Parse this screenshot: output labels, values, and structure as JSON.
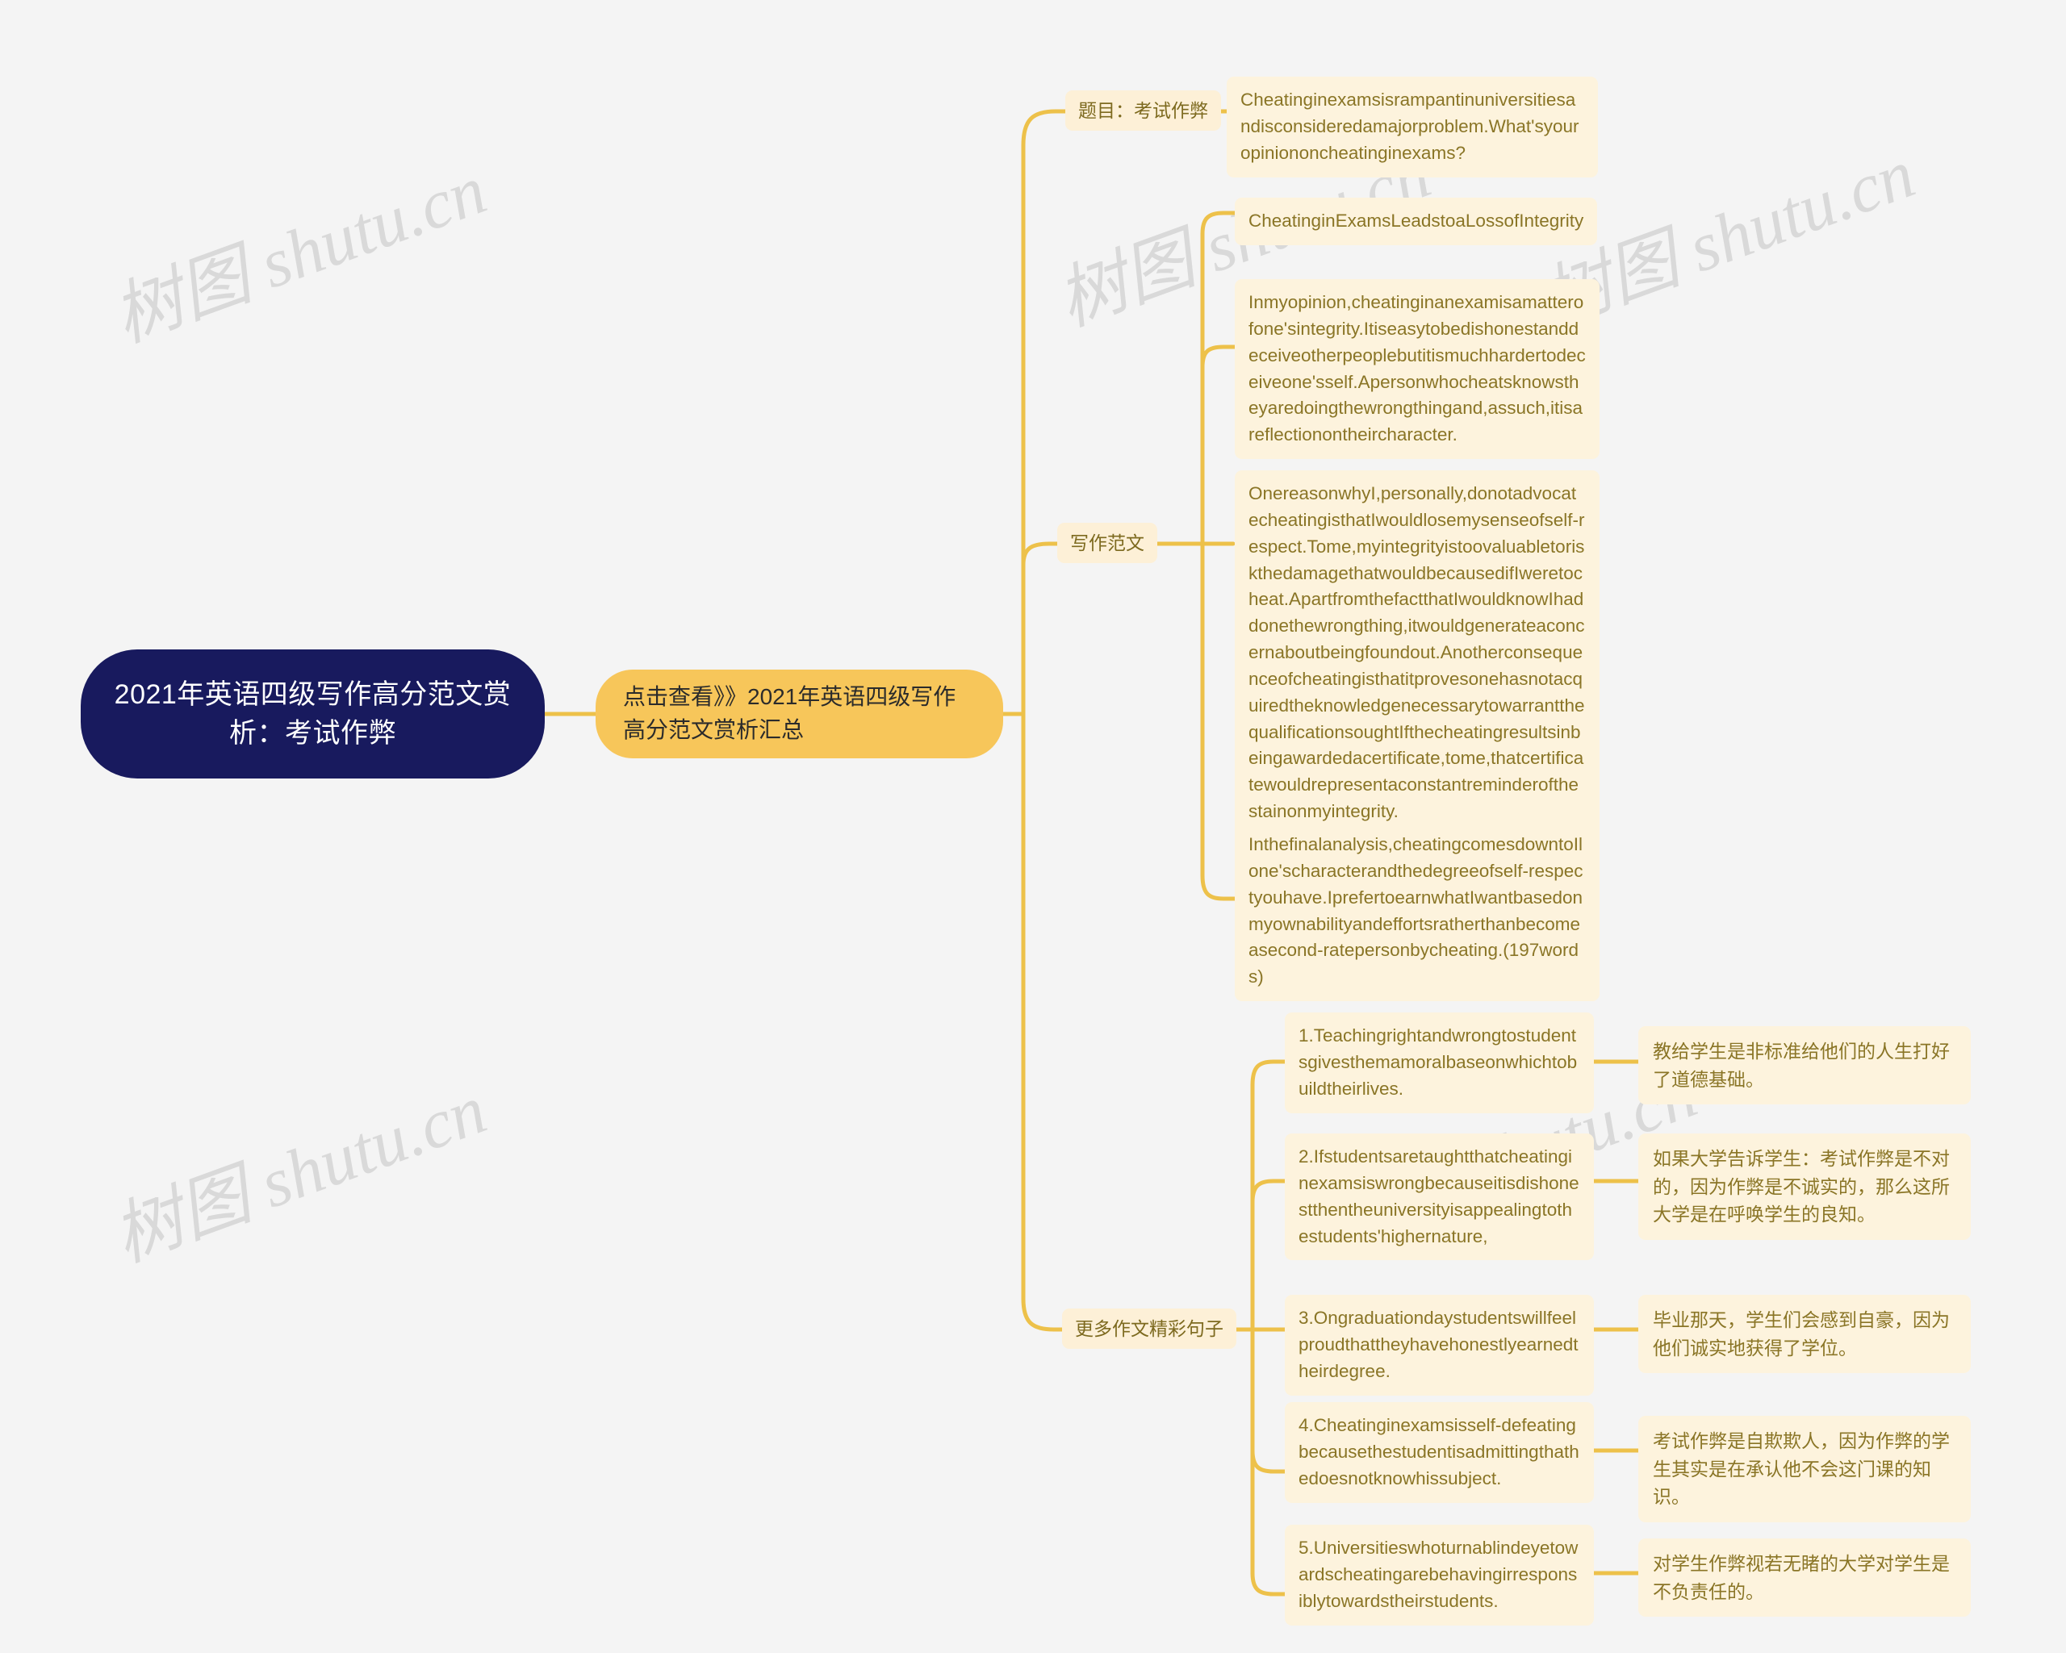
{
  "theme": {
    "background": "#f4f4f4",
    "root_bg": "#181a5e",
    "root_text": "#ffffff",
    "accent_bg": "#f7c65a",
    "node_bg": "#fdf3dd",
    "node_text": "#8a7526",
    "connector": "#edc14a",
    "watermark": "#d9d9d9"
  },
  "watermarks": [
    {
      "text": "树图 shutu.cn"
    },
    {
      "text": "树图 shutu.cn"
    },
    {
      "text": "树图 shutu.cn"
    },
    {
      "text": "树图 shutu.cn"
    },
    {
      "text": "树图 shutu.cn"
    }
  ],
  "root": {
    "title": "2021年英语四级写作高分范文赏析：考试作弊"
  },
  "link_node": {
    "label": "点击查看》》2021年英语四级写作高分范文赏析汇总"
  },
  "branches": [
    {
      "label": "题目：考试作弊"
    },
    {
      "label": "写作范文"
    },
    {
      "label": "更多作文精彩句子"
    }
  ],
  "topic": {
    "prompt": "Cheatinginexamsisrampantinuniversitiesandisconsideredamajorproblem.What'syouropiniononcheatinginexams?"
  },
  "essay": {
    "title": "CheatinginExamsLeadstoaLossofIntegrity",
    "paragraphs": [
      "Inmyopinion,cheatinginanexamisamatterofone'sintegrity.Itiseasytobedishonestanddeceiveotherpeoplebutitismuchhardertodeceiveone'sself.Apersonwhocheatsknowstheyaredoingthewrongthingand,assuch,itisareflectionontheircharacter.",
      "OnereasonwhyI,personally,donotadvocatecheatingisthatIwouldlosemysenseofself-respect.Tome,myintegrityistoovaluabletoriskthedamagethatwouldbecausedifIweretocheat.ApartfromthefactthatIwouldknowIhaddonethewrongthing,itwouldgenerateaconcernaboutbeingfoundout.AnotherconsequenceofcheatingisthatitprovesonehasnotacquiredtheknowledgenecessarytowarrantthequalificationsoughtIfthecheatingresultsinbeingawardedacertificate,tome,thatcertificatewouldrepresentaconstantreminderofthestainonmyintegrity.",
      "Inthefinalanalysis,cheatingcomesdowntoIlone'scharacterandthedegreeofself-respectyouhave.IprefertoearnwhatIwantbasedonmyownabilityandeffortsratherthanbecomeasecond-ratepersonbycheating.(197words)"
    ]
  },
  "sentences": [
    {
      "en": "1.Teachingrightandwrongtostudentsgivesthemamoralbaseonwhichtobuildtheirlives.",
      "zh": "教给学生是非标准给他们的人生打好了道德基础。"
    },
    {
      "en": "2.Ifstudentsaretaughtthatcheatinginexamsiswrongbecauseitisdishonestthentheuniversityisappealingtothestudents'highernature,",
      "zh": "如果大学告诉学生：考试作弊是不对的，因为作弊是不诚实的，那么这所大学是在呼唤学生的良知。"
    },
    {
      "en": "3.Ongraduationdaystudentswillfeelproudthattheyhavehonestlyearnedtheirdegree.",
      "zh": "毕业那天，学生们会感到自豪，因为他们诚实地获得了学位。"
    },
    {
      "en": "4.Cheatinginexamsisself-defeatingbecausethestudentisadmittingthathedoesnotknowhissubject.",
      "zh": "考试作弊是自欺欺人，因为作弊的学生其实是在承认他不会这门课的知识。"
    },
    {
      "en": "5.Universitieswhoturnablindeyetowardscheatingarebehavingirresponsiblytowardstheirstudents.",
      "zh": "对学生作弊视若无睹的大学对学生是不负责任的。"
    }
  ]
}
